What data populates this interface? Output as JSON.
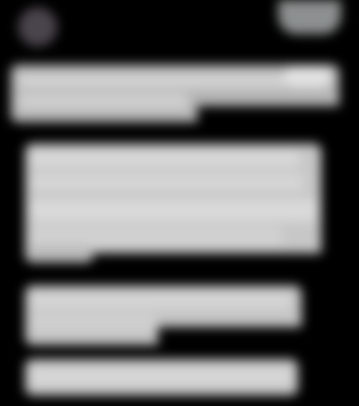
{
  "header": {
    "avatar_icon": "avatar-icon",
    "username": "",
    "action_label": ""
  },
  "blocks": [
    {
      "label": ""
    },
    {
      "label": ""
    },
    {
      "label": ""
    },
    {
      "label": ""
    }
  ]
}
